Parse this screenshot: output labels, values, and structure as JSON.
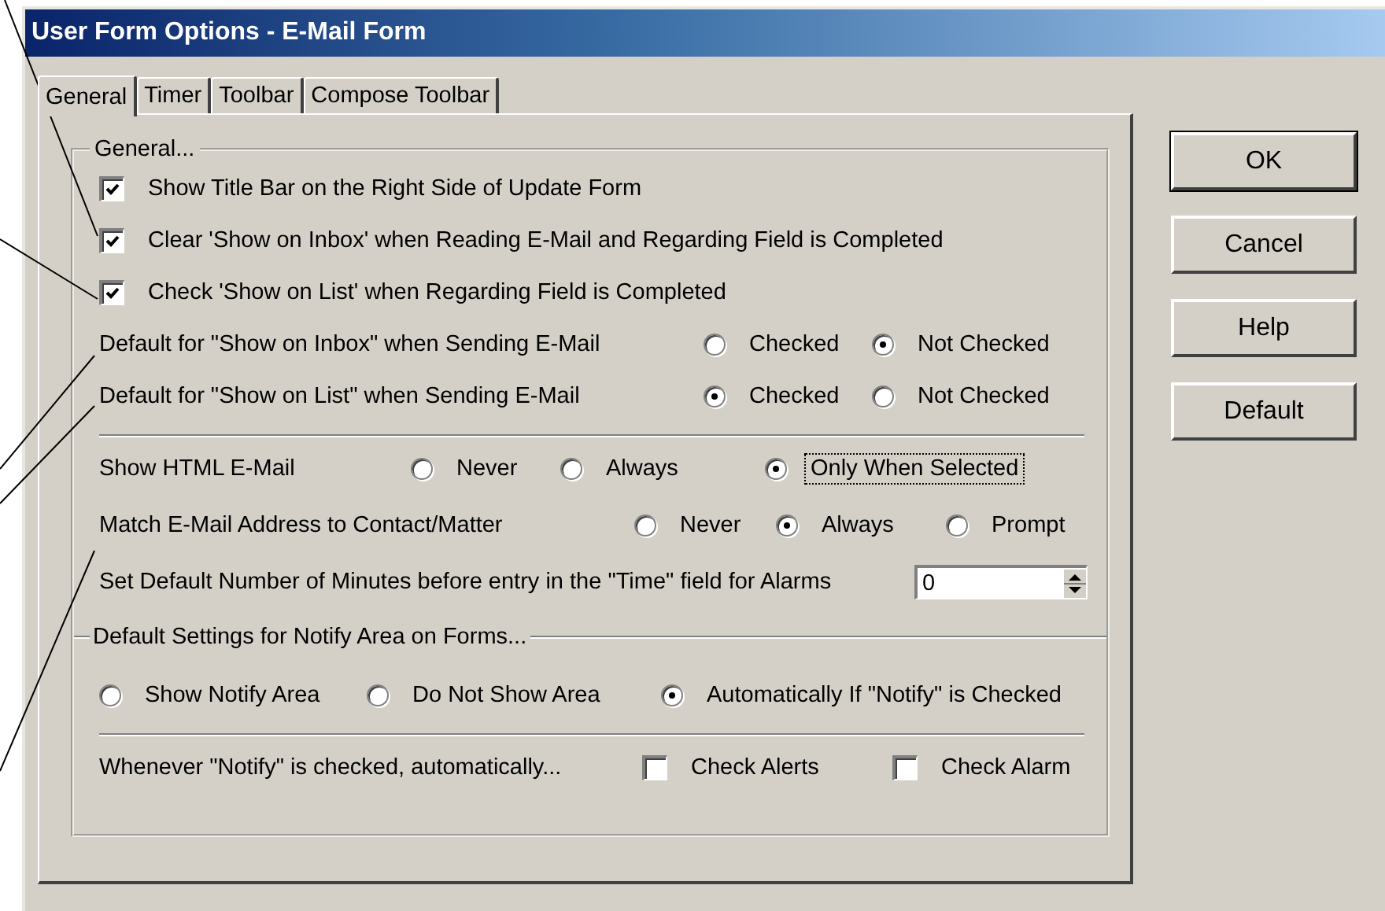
{
  "window": {
    "title": "User Form Options - E-Mail Form"
  },
  "tabs": [
    {
      "label": "General",
      "selected": true
    },
    {
      "label": "Timer",
      "selected": false
    },
    {
      "label": "Toolbar",
      "selected": false
    },
    {
      "label": "Compose Toolbar",
      "selected": false
    }
  ],
  "general": {
    "legend": "General...",
    "checkboxes": [
      {
        "label": "Show Title Bar on the Right Side of Update Form",
        "checked": true
      },
      {
        "label": "Clear 'Show on Inbox' when Reading E-Mail and Regarding Field is Completed",
        "checked": true
      },
      {
        "label": "Check 'Show on List' when Regarding Field is Completed",
        "checked": true
      }
    ],
    "defaults": [
      {
        "label": "Default for \"Show on Inbox\" when Sending E-Mail",
        "options": [
          {
            "label": "Checked",
            "selected": false
          },
          {
            "label": "Not Checked",
            "selected": true
          }
        ]
      },
      {
        "label": "Default for \"Show on List\" when Sending E-Mail",
        "options": [
          {
            "label": "Checked",
            "selected": true
          },
          {
            "label": "Not Checked",
            "selected": false
          }
        ]
      }
    ]
  },
  "email": [
    {
      "kind": "radio",
      "label": "Show HTML E-Mail",
      "options": [
        {
          "label": "Never",
          "selected": false,
          "focused": false
        },
        {
          "label": "Always",
          "selected": false,
          "focused": false
        },
        {
          "label": "Only When Selected",
          "selected": true,
          "focused": true
        }
      ]
    },
    {
      "kind": "radio",
      "label": "Match E-Mail Address to Contact/Matter",
      "options": [
        {
          "label": "Never",
          "selected": false,
          "focused": false
        },
        {
          "label": "Always",
          "selected": true,
          "focused": false
        },
        {
          "label": "Prompt",
          "selected": false,
          "focused": false
        }
      ]
    },
    {
      "kind": "spin",
      "label": "Set Default Number of Minutes before entry in the \"Time\" field for Alarms",
      "value": "0"
    }
  ],
  "notify": {
    "legend": "Default Settings for Notify Area on Forms...",
    "options": [
      {
        "label": "Show Notify Area",
        "selected": false
      },
      {
        "label": "Do Not Show Area",
        "selected": false
      },
      {
        "label": "Automatically If \"Notify\" is Checked",
        "selected": true
      }
    ]
  },
  "auto": {
    "label": "Whenever \"Notify\" is checked, automatically...",
    "options": [
      {
        "label": "Check Alerts",
        "checked": false
      },
      {
        "label": "Check Alarm",
        "checked": false
      }
    ]
  },
  "buttons": [
    {
      "label": "OK",
      "default": true
    },
    {
      "label": "Cancel",
      "default": false
    },
    {
      "label": "Help",
      "default": false
    },
    {
      "label": "Default",
      "default": false
    }
  ]
}
